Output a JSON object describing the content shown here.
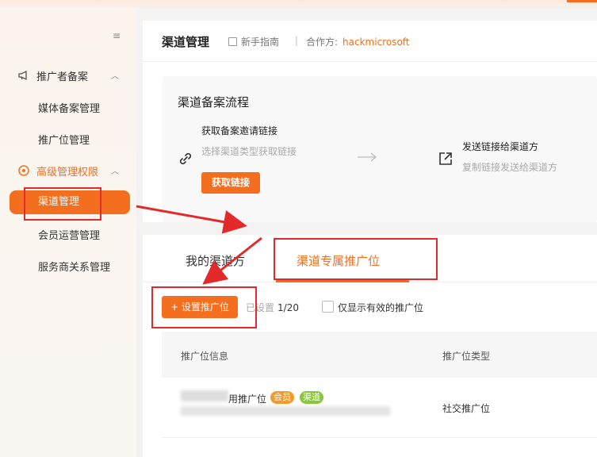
{
  "sidebar": {
    "groups": [
      {
        "label": "推广者备案",
        "items": [
          "媒体备案管理",
          "推广位管理"
        ]
      },
      {
        "label": "高级管理权限",
        "items": [
          "渠道管理",
          "会员运营管理",
          "服务商关系管理"
        ]
      }
    ]
  },
  "header": {
    "title": "渠道管理",
    "guide": "新手指南",
    "separator": "|",
    "partner_label": "合作方:",
    "partner_value": "hackmicrosoft"
  },
  "flow": {
    "title": "渠道备案流程",
    "step1_title": "获取备案邀请链接",
    "step1_desc": "选择渠道类型获取链接",
    "step1_button": "获取链接",
    "step2_title": "发送链接给渠道方",
    "step2_desc": "复制链接发送给渠道方"
  },
  "tabs": [
    "我的渠道方",
    "渠道专属推广位"
  ],
  "toolbar": {
    "set_button": "+ 设置推广位",
    "set_count_label": "已设置",
    "set_count_value": "1/20",
    "checkbox_label": "仅显示有效的推广位"
  },
  "table": {
    "columns": [
      "推广位信息",
      "推广位类型"
    ],
    "rows": [
      {
        "name": "用推广位",
        "tags": [
          "会员",
          "渠道"
        ],
        "type": "社交推广位"
      }
    ]
  },
  "colors": {
    "accent": "#f36f1f",
    "annotation": "#e22a2a",
    "tag_vip": "#f39a2a",
    "tag_channel": "#8cc63f"
  }
}
